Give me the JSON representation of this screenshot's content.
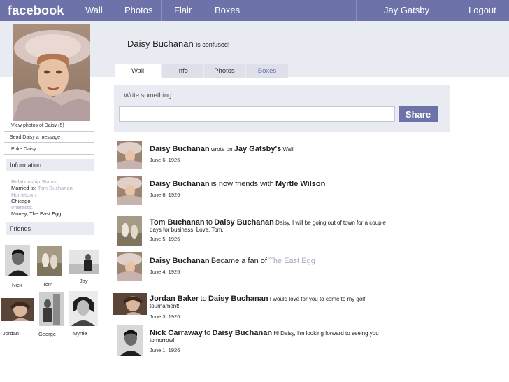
{
  "topbar": {
    "logo": "facebook",
    "nav": [
      "Wall",
      "Photos",
      "Flair",
      "Boxes"
    ],
    "user": "Jay Gatsby",
    "logout": "Logout",
    "color": "#6d72a8"
  },
  "profile": {
    "name": "Daisy Buchanan",
    "status": "is confused!"
  },
  "tabs": [
    "Wall",
    "Info",
    "Photos",
    "Boxes"
  ],
  "left": {
    "links": [
      "View photos of Daisy (5)",
      "Send Daisy a message",
      "Poke Daisy"
    ],
    "information_header": "Information",
    "info": {
      "relationship_label": "Relationship Status:",
      "married_label": "Married to:",
      "married_value": "Tom Buchanan",
      "hometown_label": "Hometown:",
      "hometown_value": "Chicago",
      "interests_label": "Interests:",
      "interests_value": "Money, The East Egg"
    },
    "friends_header": "Friends",
    "friends": [
      "Nick",
      "Tom",
      "Jay",
      "Jordan",
      "George",
      "Myrtle"
    ]
  },
  "publisher": {
    "placeholder": "Write something…",
    "share_label": "Share"
  },
  "feed": [
    {
      "n1": "Daisy Buchanan",
      "act": "wrote on",
      "n2": "Jay Gatsby's",
      "tail": "Wall",
      "date": "June 6, 1926"
    },
    {
      "n1": "Daisy Buchanan",
      "act": "is now friends with",
      "n2": "Myrtle Wilson",
      "date": "June 6, 1926"
    },
    {
      "n1": "Tom Buchanan",
      "act": "to",
      "n2": "Daisy Buchanan",
      "msg": "Daisy, I will be going out of town for a couple days for business. Love, Tom.",
      "date": "June 5, 1926"
    },
    {
      "n1": "Daisy Buchanan",
      "act": "Became a fan of",
      "n2": "The East Egg",
      "date": "June 4, 1926"
    },
    {
      "n1": "Jordan Baker",
      "act": "to",
      "n2": "Daisy Buchanan",
      "msg": "I would love for you to come to my golf tournament!",
      "date": "June 3, 1926"
    },
    {
      "n1": "Nick Carraway",
      "act": "to",
      "n2": "Daisy Buchanan",
      "msg": "Hi Daisy, I'm looking forward to seeing you tomorrow!",
      "date": "June 1, 1926"
    }
  ]
}
